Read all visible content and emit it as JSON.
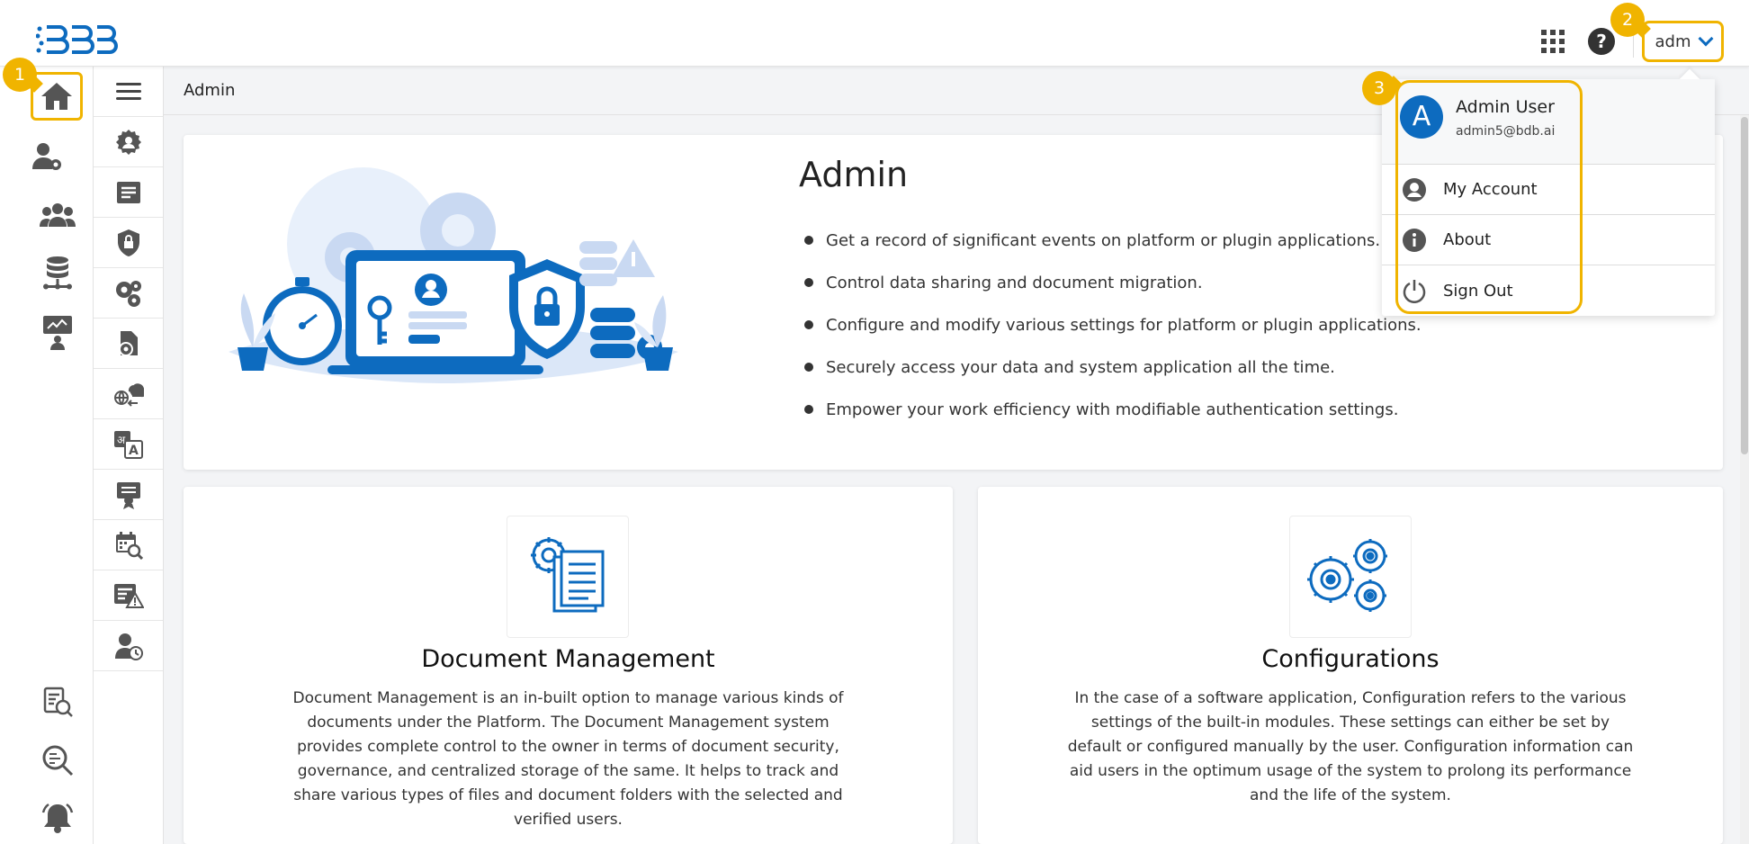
{
  "header": {
    "logo_text": "BDB",
    "user_button_label": "adm"
  },
  "badges": [
    "1",
    "2",
    "3"
  ],
  "breadcrumb": {
    "title": "Admin"
  },
  "hero": {
    "title": "Admin",
    "bullets": [
      "Get a record of significant events on platform or plugin applications.",
      "Control data sharing and document migration.",
      "Configure and modify various settings for platform or plugin applications.",
      "Securely access your data and system application all the time.",
      "Empower your work efficiency with modifiable authentication settings."
    ]
  },
  "cards": [
    {
      "title": "Document Management",
      "description": "Document Management is an in-built option to manage various kinds of documents under the Platform. The Document Management system provides complete control to the owner in terms of document security, governance, and centralized storage of the same. It helps to track and share various types of files and document folders with the selected and verified users.",
      "icon": "document-gear-icon"
    },
    {
      "title": "Configurations",
      "description": "In the case of a software application, Configuration refers to the various settings of the built-in modules. These settings can either be set by default or configured manually by the user. Configuration information can aid users in the optimum usage of the system to prolong its performance and the life of the system.",
      "icon": "gears-icon"
    }
  ],
  "user_menu": {
    "avatar_letter": "A",
    "name": "Admin User",
    "email": "admin5@bdb.ai",
    "items": [
      {
        "label": "My Account",
        "icon": "account-circle-icon"
      },
      {
        "label": "About",
        "icon": "info-icon"
      },
      {
        "label": "Sign Out",
        "icon": "power-icon"
      }
    ]
  },
  "colors": {
    "accent": "#0d6bbf",
    "highlight": "#f0b400"
  }
}
